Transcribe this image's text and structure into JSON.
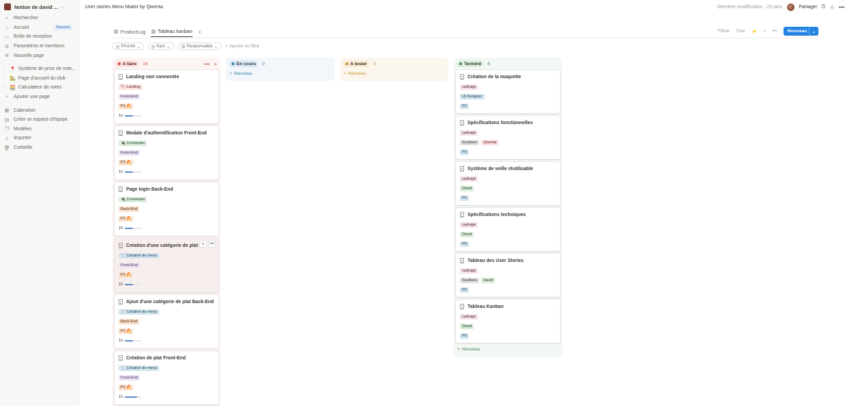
{
  "workspace": {
    "name": "Notion de david ...",
    "chevron": "⌄"
  },
  "sidebar": {
    "top": [
      {
        "icon": "search-icon",
        "label": "Rechercher"
      },
      {
        "icon": "home-icon",
        "label": "Accueil",
        "tag": "Nouveau"
      },
      {
        "icon": "inbox-icon",
        "label": "Boîte de réception"
      },
      {
        "icon": "settings-icon",
        "label": "Paramètres et membres"
      },
      {
        "icon": "plus-circle-icon",
        "label": "Nouvelle page"
      }
    ],
    "pages": [
      {
        "emoji": "📍",
        "label": "Système de prise de note..."
      },
      {
        "emoji": "🏡",
        "label": "Page d'accueil du club"
      },
      {
        "emoji": "🧮",
        "label": "Calculateur de notes"
      }
    ],
    "add_page": "Ajouter une page",
    "bottom": [
      {
        "icon": "calendar-icon",
        "label": "Calendrier"
      },
      {
        "icon": "team-space-icon",
        "label": "Créer un espace d'équipe"
      },
      {
        "icon": "templates-icon",
        "label": "Modèles"
      },
      {
        "icon": "import-icon",
        "label": "Importer"
      },
      {
        "icon": "trash-icon",
        "label": "Corbeille"
      }
    ]
  },
  "topbar": {
    "breadcrumb": "User stories Menu Maker by Qwenta",
    "last_modified": "Dernière modification : 23 janv.",
    "share": "Partager"
  },
  "tabs": [
    {
      "label": "ProductLog",
      "active": false
    },
    {
      "label": "Tableau kanban",
      "active": true
    }
  ],
  "view_tools": {
    "filter": "Filtrer",
    "sort": "Trier",
    "new": "Nouveau"
  },
  "filters": [
    {
      "label": "Priorité"
    },
    {
      "label": "Epic"
    },
    {
      "label": "Responsable"
    }
  ],
  "add_filter": "Ajouter un filtre",
  "columns": {
    "todo": {
      "label": "A faire",
      "count": "24",
      "color": "#d44c47"
    },
    "prog": {
      "label": "En cours",
      "count": "0",
      "color": "#337ea9",
      "new": "Nouveau"
    },
    "test": {
      "label": "A tester",
      "count": "0",
      "color": "#cb912f",
      "new": "Nouveau"
    },
    "done": {
      "label": "Terminé",
      "count": "6",
      "color": "#448361",
      "new": "Nouveau"
    }
  },
  "todo_cards": [
    {
      "title": "Landing non connectée",
      "epic": "🏷 Landing",
      "team": "Front-End",
      "prio": "P1 🔥",
      "points": "10",
      "progress": 0.5
    },
    {
      "title": "Modale d'authentification Front-End",
      "epic": "🔌 Connexion",
      "team": "Front-End",
      "prio": "P1 🔥",
      "points": "10",
      "progress": 0.5
    },
    {
      "title": "Page login Back-End",
      "epic": "🔌 Connexion",
      "team": "Back-End",
      "prio": "P1 🔥",
      "points": "10",
      "progress": 0.5
    },
    {
      "title": "Création d'une catégorie de plat Fro",
      "epic": "🍴 Création de menu",
      "team": "Front-End",
      "prio": "P1 🔥",
      "points": "10",
      "progress": 0.5
    },
    {
      "title": "Ajout d'une catégorie de plat Back-End",
      "epic": "🍴 Création de menu",
      "team": "Back-End",
      "prio": "P1 🔥",
      "points": "10",
      "progress": 0.5
    },
    {
      "title": "Création de plat Front-End",
      "epic": "🍴 Création de menu",
      "team": "Front-End",
      "prio": "P1 🔥",
      "points": "15",
      "progress": 0.75
    }
  ],
  "done_cards": [
    {
      "title": "Création de la maquette",
      "epic": "cadrage",
      "people": [
        "UI Designer"
      ],
      "prio": "P0"
    },
    {
      "title": "Spécifications fonctionnelles",
      "epic": "cadrage",
      "people": [
        "Soufiane",
        "Qwenta"
      ],
      "prio": "P0"
    },
    {
      "title": "Système de veille réutilisable",
      "epic": "cadrage",
      "people": [
        "David"
      ],
      "prio": "P0"
    },
    {
      "title": "Spécifications techniques",
      "epic": "cadrage",
      "people": [
        "David"
      ],
      "prio": "P0"
    },
    {
      "title": "Tableau des User Stories",
      "epic": "cadrage",
      "people": [
        "Soufiane",
        "David"
      ],
      "prio": "P0"
    },
    {
      "title": "Tableau Kanban",
      "epic": "cadrage",
      "people": [
        "David"
      ],
      "prio": "P0"
    }
  ]
}
